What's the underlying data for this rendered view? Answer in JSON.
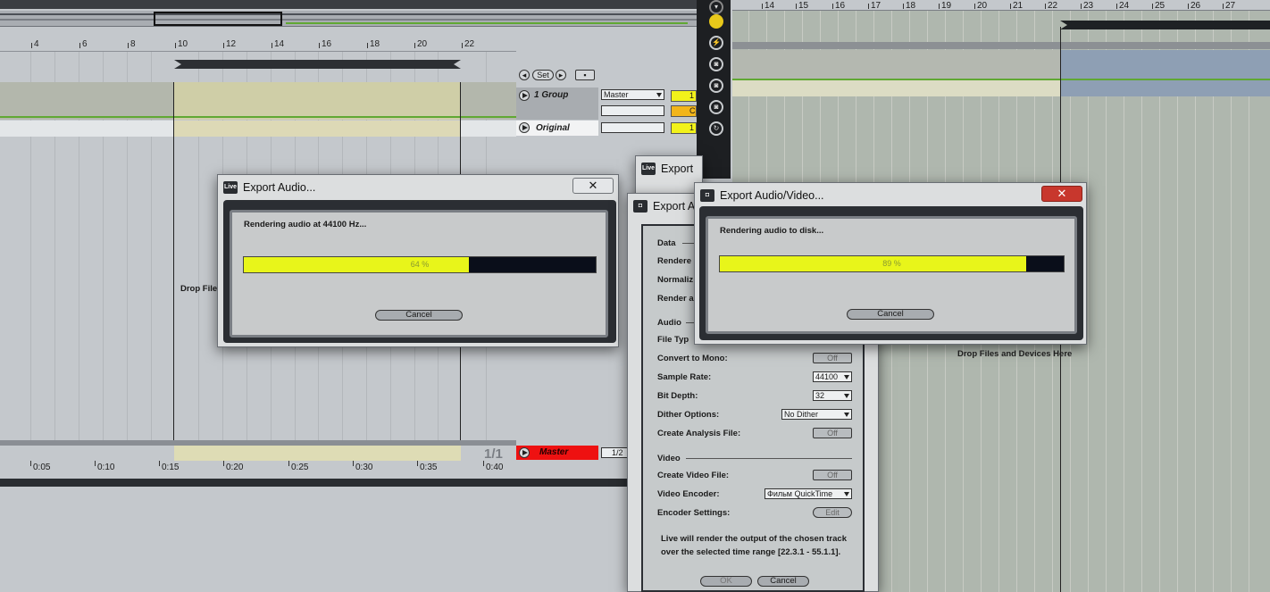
{
  "arrangement": {
    "bar_numbers": [
      "4",
      "6",
      "8",
      "10",
      "12",
      "14",
      "16",
      "18",
      "20",
      "22"
    ],
    "set_label": "Set",
    "tracks": [
      {
        "name": "1 Group",
        "output": "Master",
        "chip1": "1",
        "chip2": "C"
      },
      {
        "name": "Original",
        "chip1": "1"
      }
    ],
    "master": {
      "name": "Master",
      "fraction": "1/2"
    },
    "drop_label": "Drop Files",
    "time_labels": [
      "0:05",
      "0:10",
      "0:15",
      "0:20",
      "0:25",
      "0:30",
      "0:35",
      "0:40"
    ],
    "counter": "1/1"
  },
  "right_arrangement": {
    "bar_numbers": [
      "14",
      "15",
      "16",
      "17",
      "18",
      "19",
      "20",
      "21",
      "22",
      "23",
      "24",
      "25",
      "26",
      "27"
    ],
    "drop_label": "Drop Files and Devices Here"
  },
  "dialog_old": {
    "title": "Export Audio...",
    "logo": "Live",
    "status": "Rendering audio at 44100 Hz...",
    "progress": 0.64,
    "progress_label": "64 %",
    "cancel": "Cancel",
    "close": "✕"
  },
  "dialog_back": {
    "title": "Export",
    "logo": "Live"
  },
  "dialog_settings": {
    "title": "Export A",
    "logo": "◘",
    "sections": {
      "data": "Data",
      "audio": "Audio",
      "video": "Video"
    },
    "fields": {
      "rendered": "Rendere",
      "normalize": "Normaliz",
      "render_as": "Render a",
      "file_type": "File Typ",
      "convert_mono": "Convert to Mono:",
      "sample_rate": "Sample Rate:",
      "bit_depth": "Bit Depth:",
      "dither": "Dither Options:",
      "analysis": "Create Analysis File:",
      "create_video": "Create Video File:",
      "video_encoder": "Video Encoder:",
      "encoder_settings": "Encoder Settings:"
    },
    "values": {
      "convert_mono": "Off",
      "sample_rate": "44100",
      "bit_depth": "32",
      "dither": "No Dither",
      "analysis": "Off",
      "create_video": "Off",
      "video_encoder": "Фильм QuickTime",
      "encoder_settings": "Edit"
    },
    "note_line1": "Live will render the output of the chosen track",
    "note_line2": "over the selected time range [22.3.1 - 55.1.1].",
    "ok": "OK",
    "cancel": "Cancel"
  },
  "dialog_new": {
    "title": "Export Audio/Video...",
    "logo": "◘",
    "status": "Rendering audio to disk...",
    "progress": 0.89,
    "progress_label": "89 %",
    "cancel": "Cancel",
    "close": "✕"
  },
  "colors": {
    "accent": "#e8f51a",
    "master": "#ee1111",
    "close_red": "#c8372d"
  },
  "icons": [
    "chevron-down-icon",
    "play-icon",
    "plug-icon",
    "camera-icon",
    "loop-icon",
    "close-icon",
    "live-logo-icon"
  ]
}
